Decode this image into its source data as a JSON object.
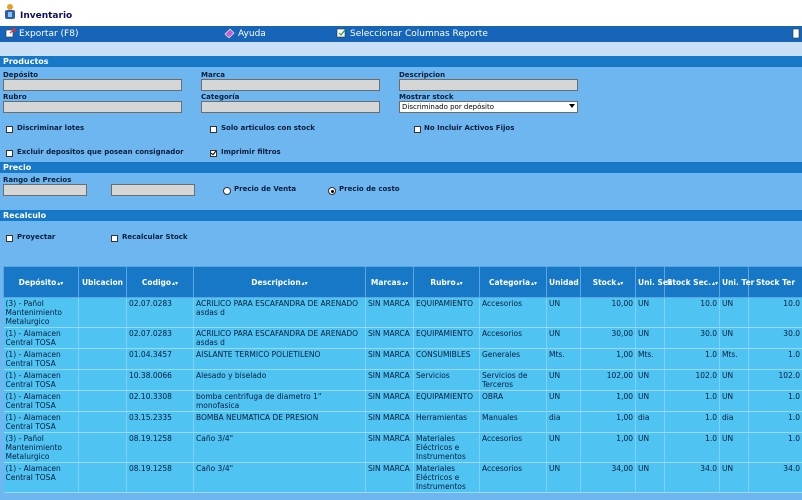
{
  "app": {
    "title": "Inventario"
  },
  "toolbar": {
    "export": "Exportar (F8)",
    "help": "Ayuda",
    "select_columns": "Seleccionar Columnas Reporte"
  },
  "productos": {
    "header": "Productos",
    "deposito_label": "Depósito",
    "marca_label": "Marca",
    "descripcion_label": "Descripcion",
    "rubro_label": "Rubro",
    "categoria_label": "Categoría",
    "mostrar_stock_label": "Mostrar stock",
    "mostrar_stock_value": "Discriminado por depósito",
    "discriminar_lotes": "Discriminar lotes",
    "solo_con_stock": "Solo articulos con stock",
    "no_incluir_activos": "No Incluir Activos Fijos",
    "excluir_consignador": "Excluir depositos que posean consignador",
    "imprimir_filtros": "Imprimir filtros"
  },
  "precio": {
    "header": "Precio",
    "rango_label": "Rango de Precios",
    "precio_venta": "Precio de Venta",
    "precio_costo": "Precio de costo"
  },
  "recalculo": {
    "header": "Recalculo",
    "proyectar": "Proyectar",
    "recalcular_stock": "Recalcular Stock"
  },
  "table": {
    "columns": [
      "Depósito",
      "Ubicacion",
      "Codigo",
      "Descripcion",
      "Marcas",
      "Rubro",
      "Categoria",
      "Unidad",
      "Stock",
      "Uni. Sec",
      "Stock Sec.",
      "Uni. Ter",
      "Stock Ter"
    ],
    "sortable": [
      true,
      false,
      true,
      true,
      true,
      true,
      true,
      false,
      true,
      false,
      true,
      false,
      false
    ],
    "rows": [
      [
        "(3) - Pañol Mantenimiento Metalurgico",
        "",
        "02.07.0283",
        "ACRILICO PARA ESCAFANDRA DE ARENADO asdas d",
        "SIN MARCA",
        "EQUIPAMIENTO",
        "Accesorios",
        "UN",
        "10,00",
        "UN",
        "10.0",
        "UN",
        "10.0"
      ],
      [
        "(1) - Alamacen Central TOSA",
        "",
        "02.07.0283",
        "ACRILICO PARA ESCAFANDRA DE ARENADO asdas d",
        "SIN MARCA",
        "EQUIPAMIENTO",
        "Accesorios",
        "UN",
        "30,00",
        "UN",
        "30.0",
        "UN",
        "30.0"
      ],
      [
        "(1) - Alamacen Central TOSA",
        "",
        "01.04.3457",
        "AISLANTE TERMICO POLIETILENO",
        "SIN MARCA",
        "CONSUMIBLES",
        "Generales",
        "Mts.",
        "1,00",
        "Mts.",
        "1.0",
        "Mts.",
        "1.0"
      ],
      [
        "(1) - Alamacen Central TOSA",
        "",
        "10.38.0066",
        "Alesado y biselado",
        "SIN MARCA",
        "Servicios",
        "Servicios de Terceros",
        "UN",
        "102,00",
        "UN",
        "102.0",
        "UN",
        "102.0"
      ],
      [
        "(1) - Alamacen Central TOSA",
        "",
        "02.10.3308",
        "bomba centrifuga de diametro 1\" monofasica",
        "SIN MARCA",
        "EQUIPAMIENTO",
        "OBRA",
        "UN",
        "1,00",
        "UN",
        "1.0",
        "UN",
        "1.0"
      ],
      [
        "(1) - Alamacen Central TOSA",
        "",
        "03.15.2335",
        "BOMBA NEUMATICA DE PRESION",
        "SIN MARCA",
        "Herramientas",
        "Manuales",
        "dia",
        "1,00",
        "dia",
        "1.0",
        "dia",
        "1.0"
      ],
      [
        "(3) - Pañol Mantenimiento Metalurgico",
        "",
        "08.19.1258",
        "Caño 3/4\"",
        "SIN MARCA",
        "Materiales Eléctricos e Instrumentos",
        "Accesorios",
        "UN",
        "1,00",
        "UN",
        "1.0",
        "UN",
        "1.0"
      ],
      [
        "(1) - Alamacen Central TOSA",
        "",
        "08.19.1258",
        "Caño 3/4\"",
        "SIN MARCA",
        "Materiales Eléctricos e Instrumentos",
        "Accesorios",
        "UN",
        "34,00",
        "UN",
        "34.0",
        "UN",
        "34.0"
      ]
    ]
  }
}
